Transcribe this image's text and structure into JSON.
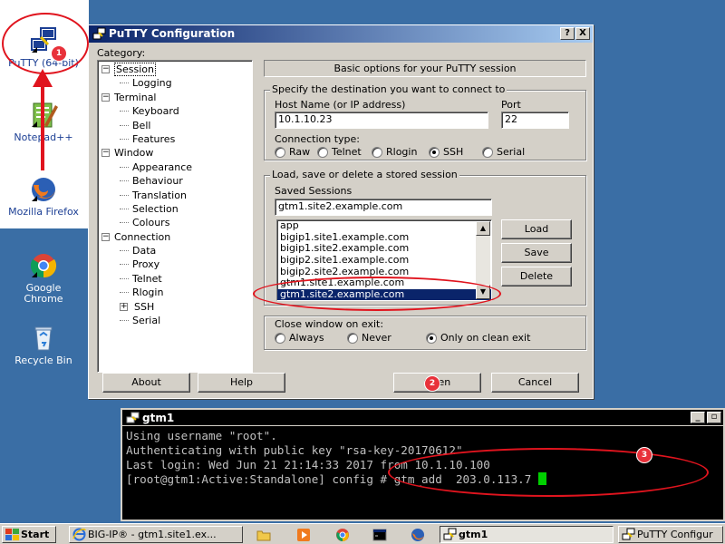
{
  "desktop": {
    "icons": [
      {
        "label": "PuTTY (64-bit)",
        "icon": "putty-icon"
      },
      {
        "label": "Notepad++",
        "icon": "notepadpp-icon"
      },
      {
        "label": "Mozilla Firefox",
        "icon": "firefox-icon"
      },
      {
        "label": "Google Chrome",
        "icon": "chrome-icon"
      },
      {
        "label": "Recycle Bin",
        "icon": "recycle-bin-icon"
      }
    ]
  },
  "putty": {
    "title": "PuTTY Configuration",
    "help_btn": "?",
    "close_btn": "X",
    "category_label": "Category:",
    "tree": [
      {
        "label": "Session",
        "level": 0,
        "expander": "-",
        "selected": true
      },
      {
        "label": "Logging",
        "level": 1
      },
      {
        "label": "Terminal",
        "level": 0,
        "expander": "-"
      },
      {
        "label": "Keyboard",
        "level": 1
      },
      {
        "label": "Bell",
        "level": 1
      },
      {
        "label": "Features",
        "level": 1
      },
      {
        "label": "Window",
        "level": 0,
        "expander": "-"
      },
      {
        "label": "Appearance",
        "level": 1
      },
      {
        "label": "Behaviour",
        "level": 1
      },
      {
        "label": "Translation",
        "level": 1
      },
      {
        "label": "Selection",
        "level": 1
      },
      {
        "label": "Colours",
        "level": 1
      },
      {
        "label": "Connection",
        "level": 0,
        "expander": "-"
      },
      {
        "label": "Data",
        "level": 1
      },
      {
        "label": "Proxy",
        "level": 1
      },
      {
        "label": "Telnet",
        "level": 1
      },
      {
        "label": "Rlogin",
        "level": 1
      },
      {
        "label": "SSH",
        "level": 1,
        "expander": "+"
      },
      {
        "label": "Serial",
        "level": 1
      }
    ],
    "panel_title": "Basic options for your PuTTY session",
    "destination": {
      "group_title": "Specify the destination you want to connect to",
      "host_label": "Host Name (or IP address)",
      "host_value": "10.1.10.23",
      "port_label": "Port",
      "port_value": "22",
      "conn_type_label": "Connection type:",
      "conn_types": [
        "Raw",
        "Telnet",
        "Rlogin",
        "SSH",
        "Serial"
      ],
      "selected_conn_type": "SSH"
    },
    "sessions": {
      "group_title": "Load, save or delete a stored session",
      "saved_label": "Saved Sessions",
      "saved_value": "gtm1.site2.example.com",
      "list": [
        "app",
        "bigip1.site1.example.com",
        "bigip1.site2.example.com",
        "bigip2.site1.example.com",
        "bigip2.site2.example.com",
        "gtm1.site1.example.com",
        "gtm1.site2.example.com"
      ],
      "selected": "gtm1.site2.example.com",
      "load_btn": "Load",
      "save_btn": "Save",
      "delete_btn": "Delete"
    },
    "close_on_exit": {
      "label": "Close window on exit:",
      "options": [
        "Always",
        "Never",
        "Only on clean exit"
      ],
      "selected": "Only on clean exit"
    },
    "about_btn": "About",
    "help_button": "Help",
    "open_btn": "Open",
    "cancel_btn": "Cancel"
  },
  "terminal": {
    "title": "gtm1",
    "lines": [
      "Using username \"root\".",
      "Authenticating with public key \"rsa-key-20170612\"",
      "Last login: Wed Jun 21 21:14:33 2017 from 10.1.10.100",
      "[root@gtm1:Active:Standalone] config # gtm_add  203.0.113.7 "
    ],
    "restore_btn": "▫"
  },
  "taskbar": {
    "start": "Start",
    "tasks": [
      {
        "label": "BIG-IP® - gtm1.site1.ex...",
        "icon": "ie-icon"
      },
      {
        "label": "gtm1",
        "icon": "putty-icon",
        "active": true
      },
      {
        "label": "PuTTY Configur",
        "icon": "putty-icon"
      }
    ]
  },
  "annotations": [
    "1",
    "2",
    "3"
  ],
  "colors": {
    "desktop": "#3a6ea5",
    "title_active": "#0a246a",
    "selection": "#0a246a",
    "annotation": "#e0141e",
    "cursor": "#00d000"
  }
}
